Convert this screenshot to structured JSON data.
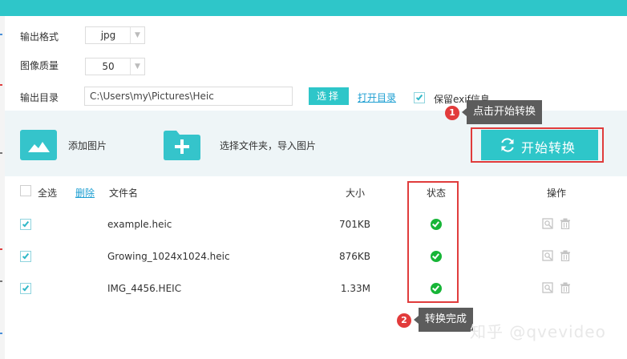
{
  "settings": {
    "format_label": "输出格式",
    "format_value": "jpg",
    "quality_label": "图像质量",
    "quality_value": "50",
    "output_dir_label": "输出目录",
    "output_dir_value": "C:\\Users\\my\\Pictures\\Heic",
    "choose_button": "选择",
    "open_dir_link": "打开目录",
    "keep_exif_label": "保留exif信息",
    "keep_exif_checked": true
  },
  "toolbar": {
    "add_image_label": "添加图片",
    "add_folder_label": "选择文件夹，导入图片",
    "start_button": "开始转换"
  },
  "annotations": {
    "step1_number": "1",
    "step1_text": "点击开始转换",
    "step2_number": "2",
    "step2_text": "转换完成"
  },
  "table": {
    "select_all": "全选",
    "delete": "删除",
    "columns": [
      "文件名",
      "大小",
      "状态",
      "操作"
    ],
    "rows": [
      {
        "filename": "example.heic",
        "size": "701KB",
        "status": "done",
        "checked": true
      },
      {
        "filename": "Growing_1024x1024.heic",
        "size": "876KB",
        "status": "done",
        "checked": true
      },
      {
        "filename": "IMG_4456.HEIC",
        "size": "1.33M",
        "status": "done",
        "checked": true
      }
    ]
  },
  "watermark": "知乎 @qvevideo",
  "colors": {
    "accent": "#2ec6c9",
    "link": "#1e9fd2",
    "highlight_red": "#e03c3c",
    "success_green": "#17b537"
  },
  "icons": {
    "add_image": "image-icon",
    "add_folder": "folder-plus-icon",
    "start": "refresh-icon",
    "status": "check-circle-icon",
    "preview": "preview-icon",
    "delete": "trash-icon"
  }
}
